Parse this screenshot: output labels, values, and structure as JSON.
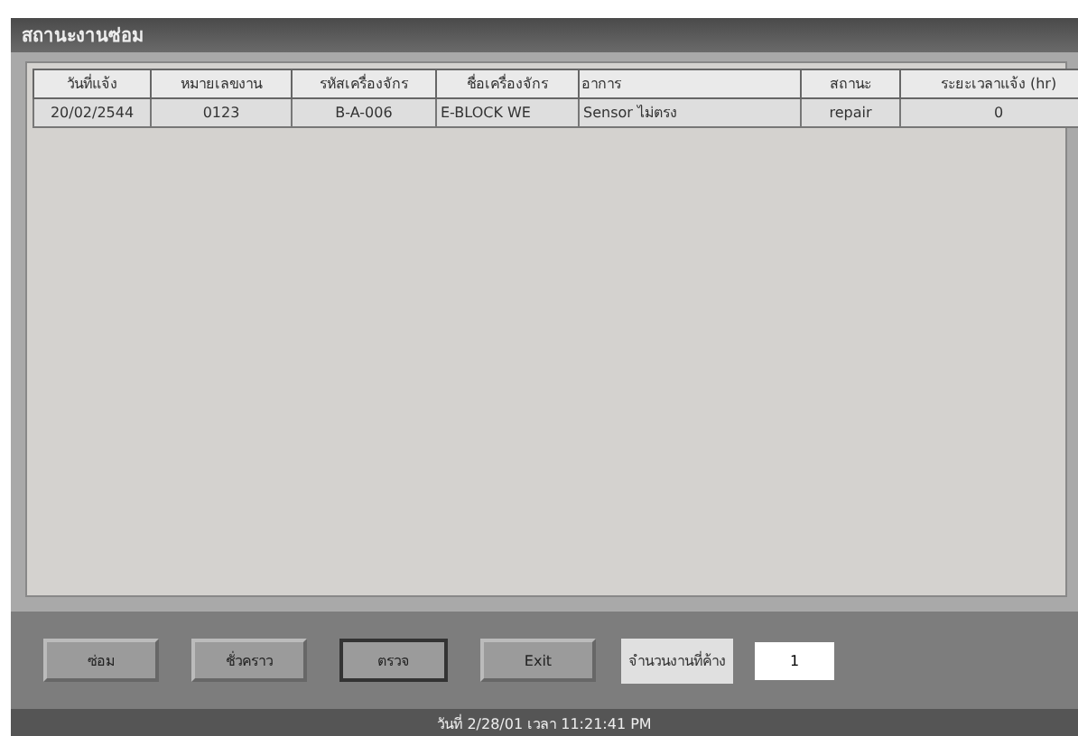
{
  "window": {
    "title": "สถานะงานซ่อม"
  },
  "table": {
    "columns": [
      "วันที่แจ้ง",
      "หมายเลขงาน",
      "รหัสเครื่องจักร",
      "ชื่อเครื่องจักร",
      "อาการ",
      "สถานะ",
      "ระยะเวลาแจ้ง (hr)"
    ],
    "rows": [
      [
        "20/02/2544",
        "0123",
        "B-A-006",
        "E-BLOCK WE",
        "Sensor ไม่ตรง",
        "repair",
        "0"
      ]
    ]
  },
  "buttons": [
    {
      "label": "ซ่อม",
      "focused": false
    },
    {
      "label": "ชั่วคราว",
      "focused": false
    },
    {
      "label": "ตรวจ",
      "focused": true
    },
    {
      "label": "Exit",
      "focused": false
    }
  ],
  "pending": {
    "label": "จำนวนงานที่ค้าง",
    "value": "1"
  },
  "status_bar": "วันที่ 2/28/01 เวลา 11:21:41 PM"
}
